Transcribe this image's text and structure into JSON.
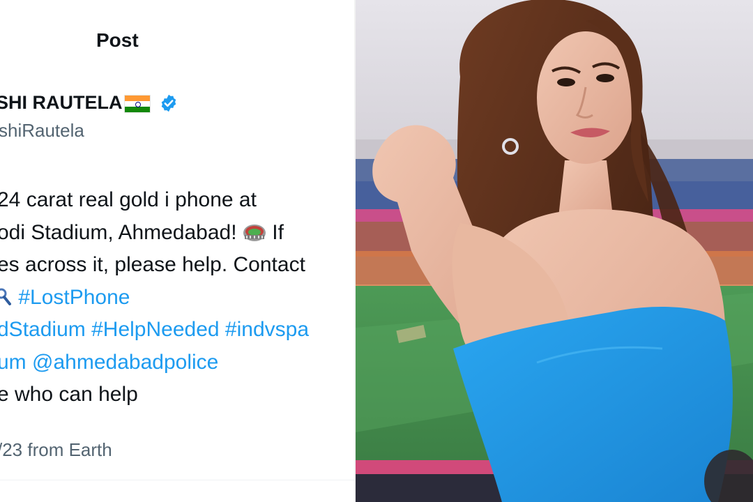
{
  "header": {
    "title": "Post"
  },
  "author": {
    "name": "SHI RAUTELA",
    "handle": "shiRautela",
    "flag_icon": "india-flag-icon",
    "verified_icon": "verified-badge-icon",
    "verified_color": "#1d9bf0"
  },
  "body": {
    "line1": "24 carat real gold i phone at",
    "line2_text": "odi Stadium, Ahmedabad!",
    "line2_after": "If",
    "line3": "es across it, please help. Contact",
    "line4_hashtag": "#LostPhone",
    "line5_parts": [
      "dStadium",
      "#HelpNeeded",
      "#indvspa"
    ],
    "line6_prefix": "um",
    "line6_mention": "@ahmedabadpolice",
    "line7": "e who can help",
    "emoji_line2": "stadium-emoji-icon",
    "emoji_line4": "magnifier-emoji-icon"
  },
  "meta": {
    "text": "/23 from Earth"
  },
  "footer": {
    "cut_text": "..."
  },
  "colors": {
    "text_primary": "#0f1419",
    "text_secondary": "#536471",
    "link": "#1d9bf0",
    "dress": "#1e9be8"
  }
}
